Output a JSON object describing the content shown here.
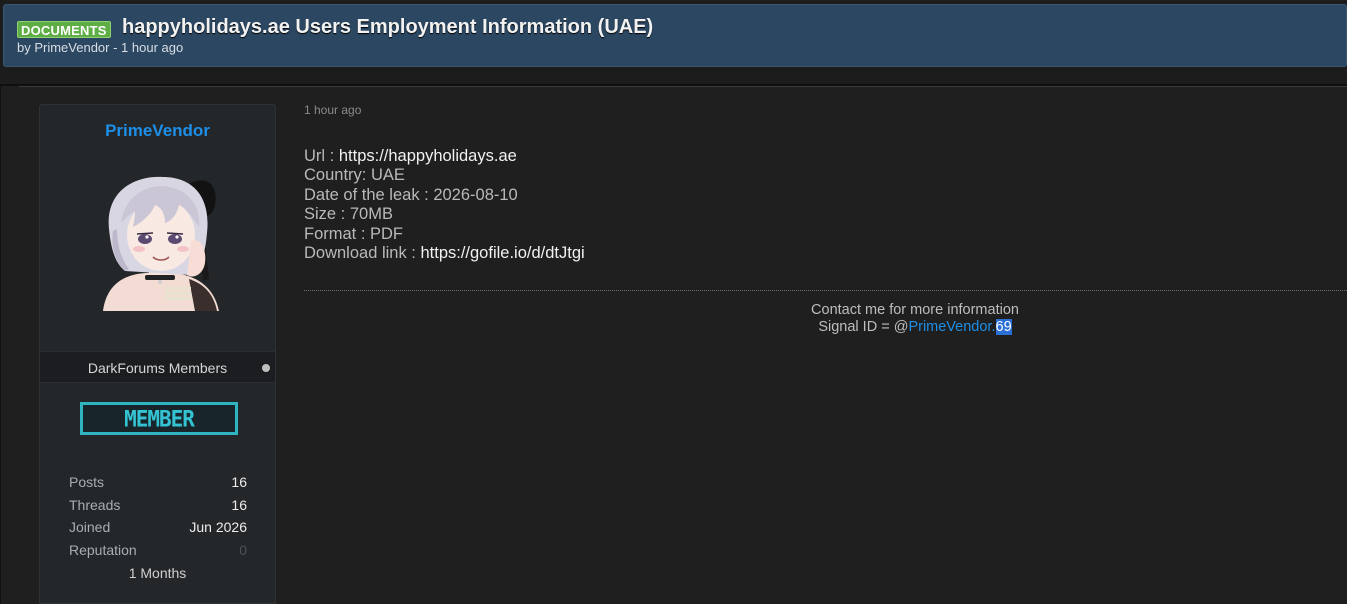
{
  "thread": {
    "prefix": "DOCUMENTS",
    "title": "happyholidays.ae Users Employment Information (UAE)",
    "meta": "by PrimeVendor - 1 hour ago"
  },
  "author": {
    "name": "PrimeVendor",
    "usergroup": "DarkForums Members",
    "badge": "MEMBER",
    "stats": [
      {
        "label": "Posts",
        "value": "16"
      },
      {
        "label": "Threads",
        "value": "16"
      },
      {
        "label": "Joined",
        "value": "Jun 2026"
      },
      {
        "label": "Reputation",
        "value": "0"
      }
    ],
    "tenure": "1 Months"
  },
  "post": {
    "date": "1 hour ago",
    "lines": [
      {
        "label": "Url : ",
        "value": "https://happyholidays.ae"
      },
      {
        "label": "Country: UAE",
        "value": ""
      },
      {
        "label": "Date of the leak : 2026-08-10",
        "value": ""
      },
      {
        "label": "Size : 70MB",
        "value": ""
      },
      {
        "label": "Format : PDF",
        "value": ""
      },
      {
        "label": "Download link : ",
        "value": "https://gofile.io/d/dtJtgi"
      }
    ],
    "contact": {
      "line1": "Contact me for more information",
      "signal_prefix": "Signal ID = @",
      "signal_name": "PrimeVendor.",
      "signal_suffix": "69"
    }
  },
  "colors": {
    "header_bg": "#2c4761",
    "prefix_green": "#5fae45",
    "link_blue": "#1d8fe8",
    "badge_cyan": "#2fb4c2"
  },
  "icons": {
    "avatar": "anime-girl-avatar",
    "online_status": "status-dot-icon"
  }
}
